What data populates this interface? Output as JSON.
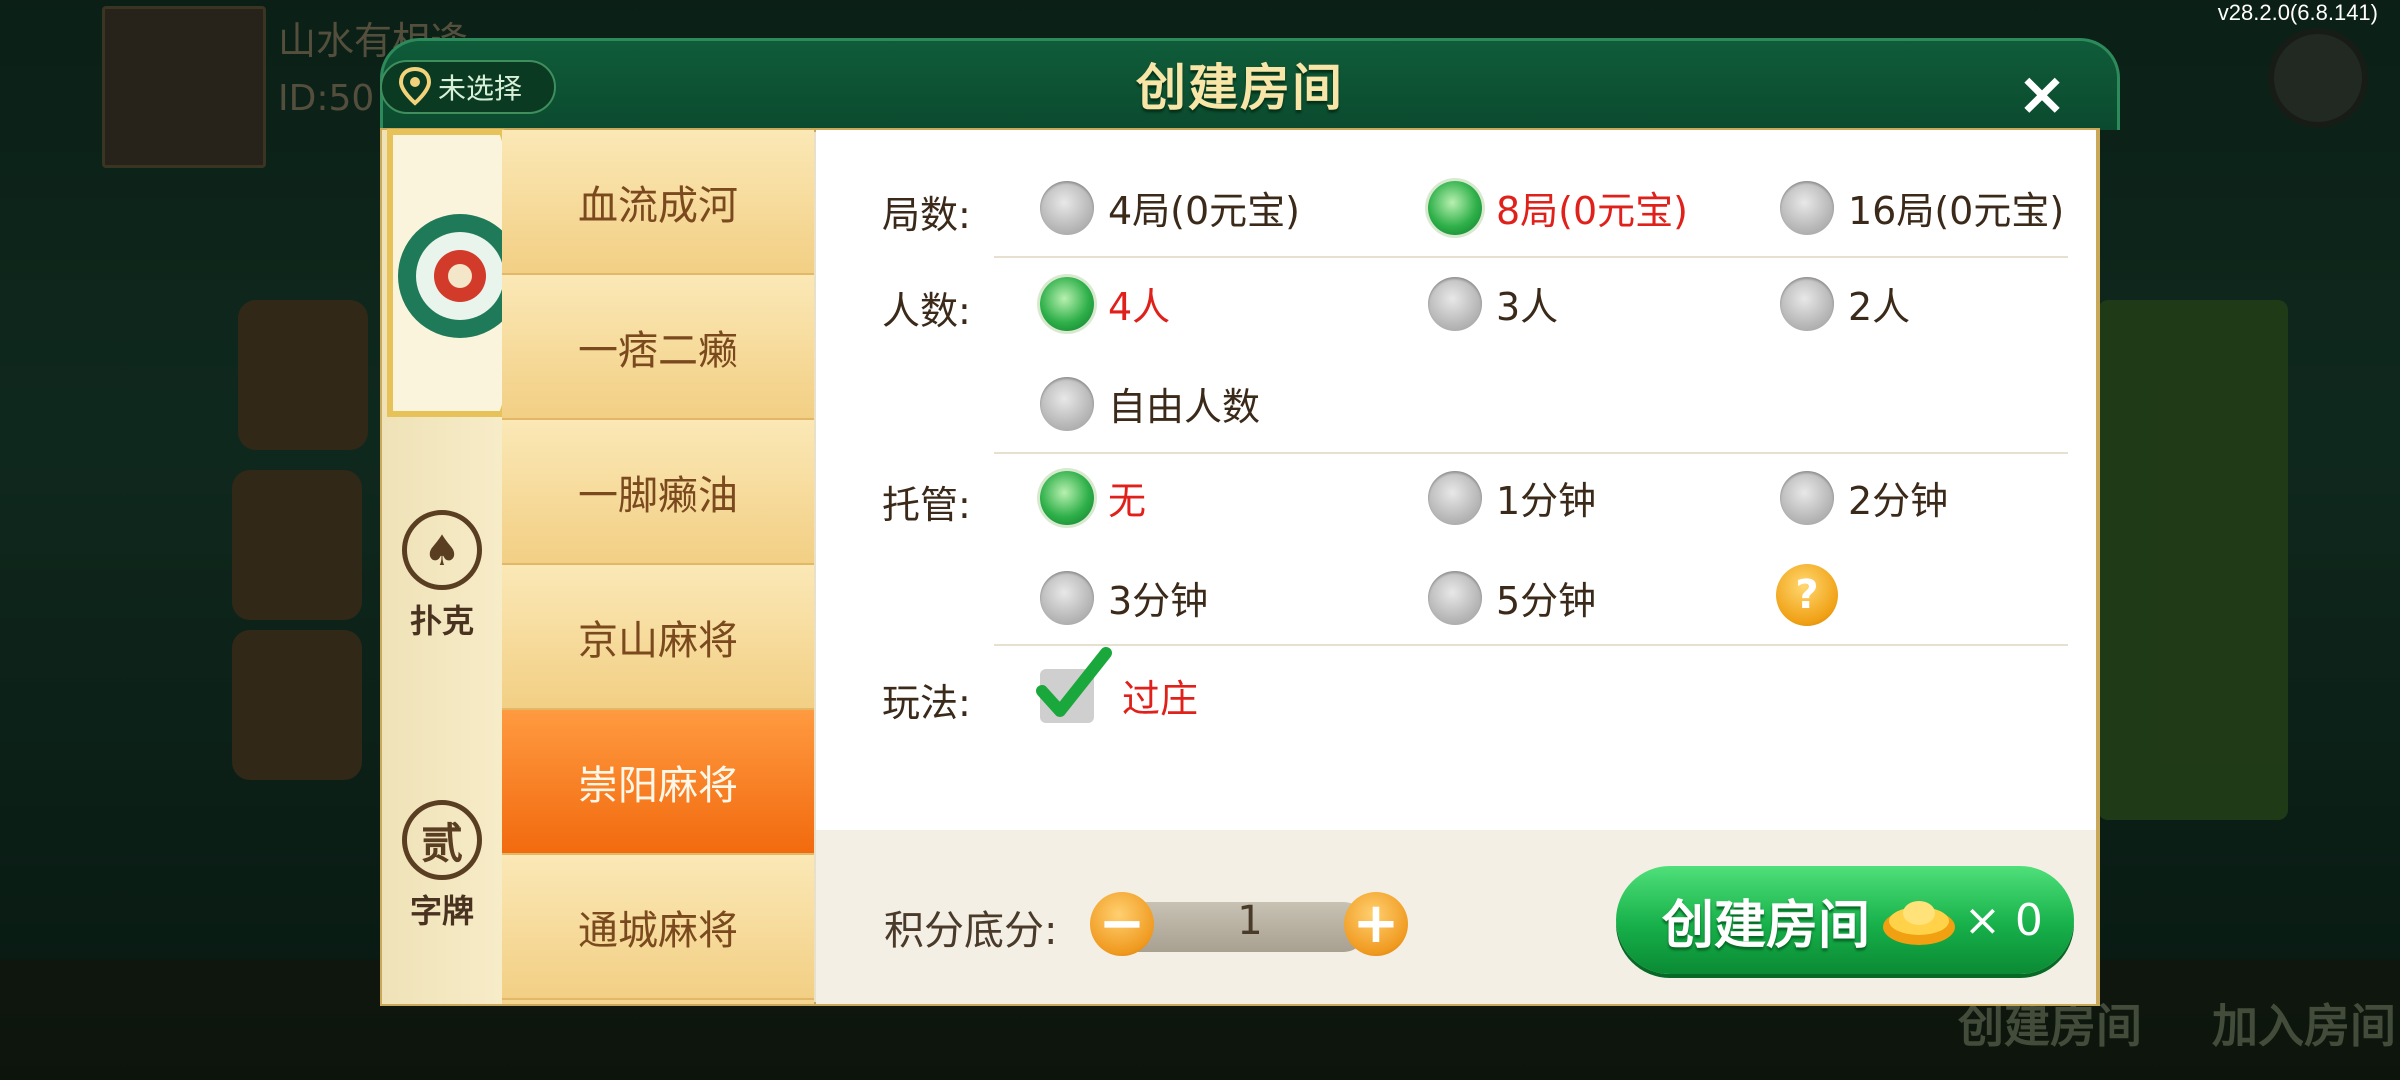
{
  "version": "v28.2.0(6.8.141)",
  "background": {
    "player_name": "山水有相逢",
    "player_id": "ID:50",
    "bottom_labels": [
      "创建房间",
      "加入房间"
    ]
  },
  "dialog": {
    "title": "创建房间",
    "location": "未选择",
    "close": "×"
  },
  "categories": [
    {
      "label": "",
      "icon": "mahjong-tile-icon",
      "active": true
    },
    {
      "label": "扑克",
      "icon": "spade-icon",
      "glyph": "♠"
    },
    {
      "label": "字牌",
      "icon": "character-tile-icon",
      "glyph": "贰"
    }
  ],
  "games": [
    {
      "label": "血流成河"
    },
    {
      "label": "一痞二癞"
    },
    {
      "label": "一脚癞油"
    },
    {
      "label": "京山麻将"
    },
    {
      "label": "崇阳麻将",
      "active": true
    },
    {
      "label": "通城麻将"
    }
  ],
  "options": {
    "rounds": {
      "label": "局数:",
      "choices": [
        "4局(0元宝)",
        "8局(0元宝)",
        "16局(0元宝)"
      ],
      "selected": "8局(0元宝)"
    },
    "players": {
      "label": "人数:",
      "choices": [
        "4人",
        "3人",
        "2人",
        "自由人数"
      ],
      "selected": "4人"
    },
    "auto": {
      "label": "托管:",
      "choices": [
        "无",
        "1分钟",
        "2分钟",
        "3分钟",
        "5分钟"
      ],
      "selected": "无",
      "help": "?"
    },
    "rules": {
      "label": "玩法:",
      "checkbox": "过庄",
      "checked": true
    }
  },
  "score": {
    "label": "积分底分:",
    "value": "1",
    "minus": "−",
    "plus": "+"
  },
  "create_button": {
    "label": "创建房间",
    "cost": "× 0"
  },
  "colors": {
    "accent_green": "#17b04a",
    "selected_text": "#e0201a",
    "active_tab": "#f26a0e"
  }
}
